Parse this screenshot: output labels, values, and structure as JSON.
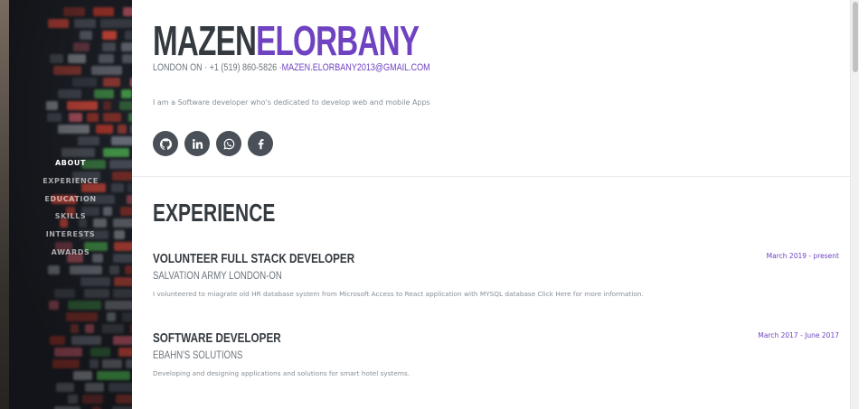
{
  "sidebar": {
    "nav": [
      {
        "label": "ABOUT",
        "active": true
      },
      {
        "label": "EXPERIENCE",
        "active": false
      },
      {
        "label": "EDUCATION",
        "active": false
      },
      {
        "label": "SKILLS",
        "active": false
      },
      {
        "label": "INTERESTS",
        "active": false
      },
      {
        "label": "AWARDS",
        "active": false
      }
    ]
  },
  "about": {
    "first_name": "MAZEN",
    "last_name": "ELORBANY",
    "contact": "LONDON ON · +1 (519) 860-5826 ·",
    "email": "MAZEN.ELORBANY2013@GMAIL.COM",
    "lead": "I am a Software developer who's dedicated to develop web and mobile Apps",
    "socials": [
      {
        "icon": "github-icon"
      },
      {
        "icon": "linkedin-icon"
      },
      {
        "icon": "whatsapp-icon"
      },
      {
        "icon": "facebook-icon"
      }
    ]
  },
  "experience": {
    "title": "EXPERIENCE",
    "jobs": [
      {
        "title": "VOLUNTEER FULL STACK DEVELOPER",
        "company": "SALVATION ARMY LONDON-ON",
        "description": "I volunteered to miagrate old HR database system from Microsoft Access to React application with MYSQL database Click Here for more information.",
        "date": "March 2019 - present"
      },
      {
        "title": "SOFTWARE DEVELOPER",
        "company": "EBAHN'S SOLUTIONS",
        "description": "Developing and designing applications and solutions for smart hotel systems.",
        "date": "March 2017 - June 2017"
      }
    ]
  },
  "colors": {
    "accent": "#6f42c1",
    "dark": "#343a40",
    "muted": "#6c757d",
    "sidebar_bg": "#1c1f26"
  }
}
